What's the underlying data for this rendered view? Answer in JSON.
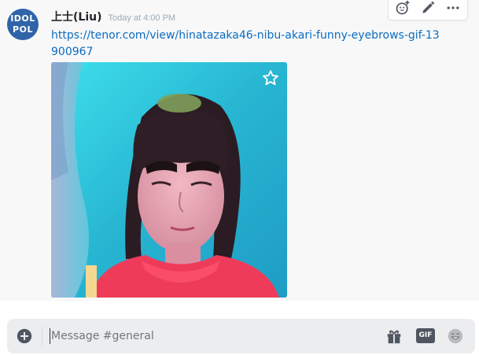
{
  "message": {
    "avatar_text_line1": "IDOL",
    "avatar_text_line2": "POL",
    "username": "上士(Liu)",
    "timestamp": "Today at 4:00 PM",
    "link_text": "https://tenor.com/view/hinatazaka46-nibu-akari-funny-eyebrows-gif-13900967",
    "embed": {
      "icon": "star-outline-icon"
    }
  },
  "toolbar": {
    "icons": [
      "add-reaction-icon",
      "edit-pencil-icon",
      "more-dots-icon"
    ]
  },
  "composer": {
    "placeholder": "Message #general",
    "value": "",
    "upload_icon": "plus-circle-icon",
    "gift_icon": "gift-icon",
    "gif_label": "GIF",
    "emoji_icon": "emoji-face-icon"
  },
  "colors": {
    "link": "#0b6cc0",
    "username": "#23262a",
    "timestamp": "#99aab5",
    "avatar_bg": "#2f64a8",
    "composer_bg": "#ebedef"
  }
}
